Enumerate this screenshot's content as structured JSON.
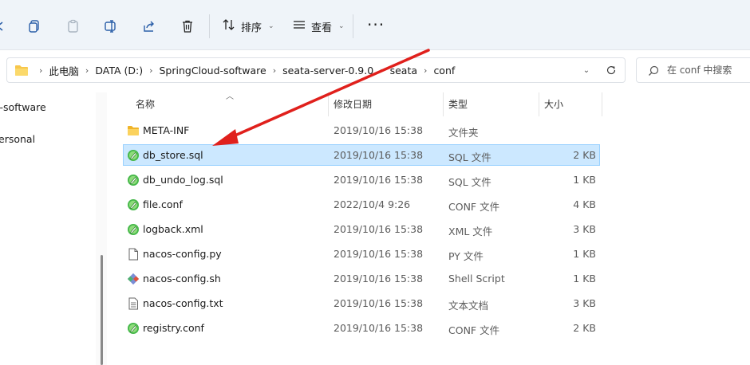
{
  "toolbar": {
    "sort_label": "排序",
    "view_label": "查看",
    "more_label": "···"
  },
  "address": {
    "crumbs": [
      "此电脑",
      "DATA (D:)",
      "SpringCloud-software",
      "seata-server-0.9.0",
      "seata",
      "conf"
    ]
  },
  "search": {
    "placeholder": "在 conf 中搜索"
  },
  "nav": {
    "items": [
      {
        "label": "l-software"
      },
      {
        "label": "ersonal"
      }
    ]
  },
  "columns": {
    "name": "名称",
    "date": "修改日期",
    "type": "类型",
    "size": "大小"
  },
  "files": [
    {
      "name": "META-INF",
      "date": "2019/10/16 15:38",
      "type": "文件夹",
      "size": "",
      "icon": "folder-icon",
      "selected": false
    },
    {
      "name": "db_store.sql",
      "date": "2019/10/16 15:38",
      "type": "SQL 文件",
      "size": "2 KB",
      "icon": "notepadpp-file-icon",
      "selected": true
    },
    {
      "name": "db_undo_log.sql",
      "date": "2019/10/16 15:38",
      "type": "SQL 文件",
      "size": "1 KB",
      "icon": "notepadpp-file-icon",
      "selected": false
    },
    {
      "name": "file.conf",
      "date": "2022/10/4 9:26",
      "type": "CONF 文件",
      "size": "4 KB",
      "icon": "notepadpp-file-icon",
      "selected": false
    },
    {
      "name": "logback.xml",
      "date": "2019/10/16 15:38",
      "type": "XML 文件",
      "size": "3 KB",
      "icon": "notepadpp-file-icon",
      "selected": false
    },
    {
      "name": "nacos-config.py",
      "date": "2019/10/16 15:38",
      "type": "PY 文件",
      "size": "1 KB",
      "icon": "blank-file-icon",
      "selected": false
    },
    {
      "name": "nacos-config.sh",
      "date": "2019/10/16 15:38",
      "type": "Shell Script",
      "size": "1 KB",
      "icon": "git-file-icon",
      "selected": false
    },
    {
      "name": "nacos-config.txt",
      "date": "2019/10/16 15:38",
      "type": "文本文档",
      "size": "3 KB",
      "icon": "text-file-icon",
      "selected": false
    },
    {
      "name": "registry.conf",
      "date": "2019/10/16 15:38",
      "type": "CONF 文件",
      "size": "2 KB",
      "icon": "notepadpp-file-icon",
      "selected": false
    }
  ],
  "colors": {
    "selection_bg": "#cce8ff",
    "selection_border": "#99d1ff",
    "annotation_arrow": "#e0201c",
    "folder_yellow": "#f8c74b"
  }
}
